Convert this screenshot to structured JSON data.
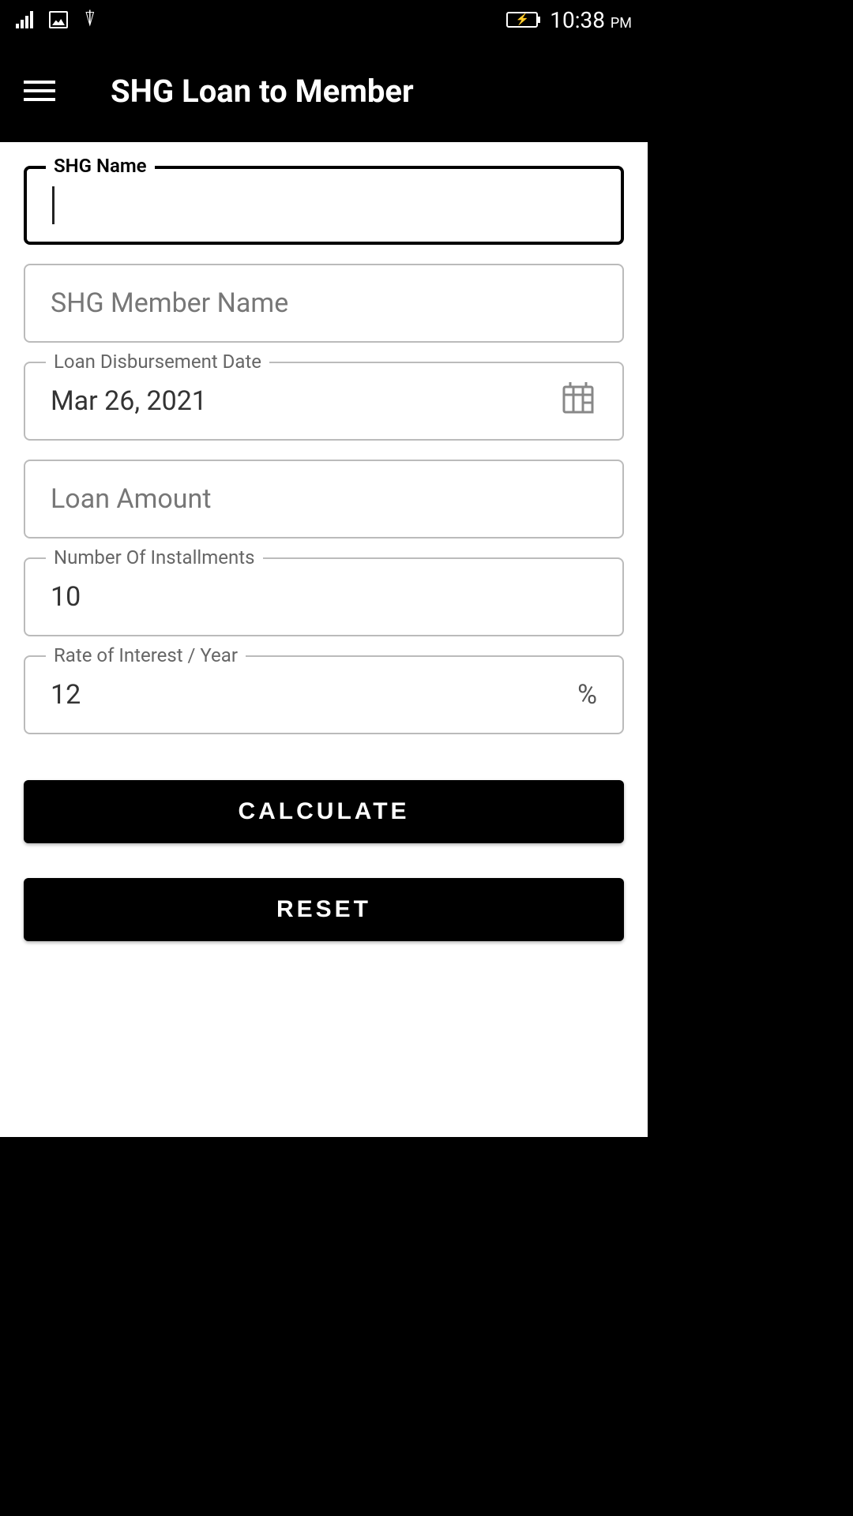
{
  "status_bar": {
    "time": "10:38",
    "time_suffix": "PM"
  },
  "header": {
    "title": "SHG Loan to Member"
  },
  "form": {
    "shg_name": {
      "label": "SHG Name",
      "value": ""
    },
    "member_name": {
      "placeholder": "SHG Member Name",
      "value": ""
    },
    "disbursement_date": {
      "label": "Loan Disbursement Date",
      "value": "Mar 26, 2021"
    },
    "loan_amount": {
      "placeholder": "Loan Amount",
      "value": ""
    },
    "installments": {
      "label": "Number Of Installments",
      "value": "10"
    },
    "interest_rate": {
      "label": "Rate of Interest / Year",
      "value": "12",
      "suffix": "%"
    }
  },
  "buttons": {
    "calculate": "CALCULATE",
    "reset": "RESET"
  }
}
